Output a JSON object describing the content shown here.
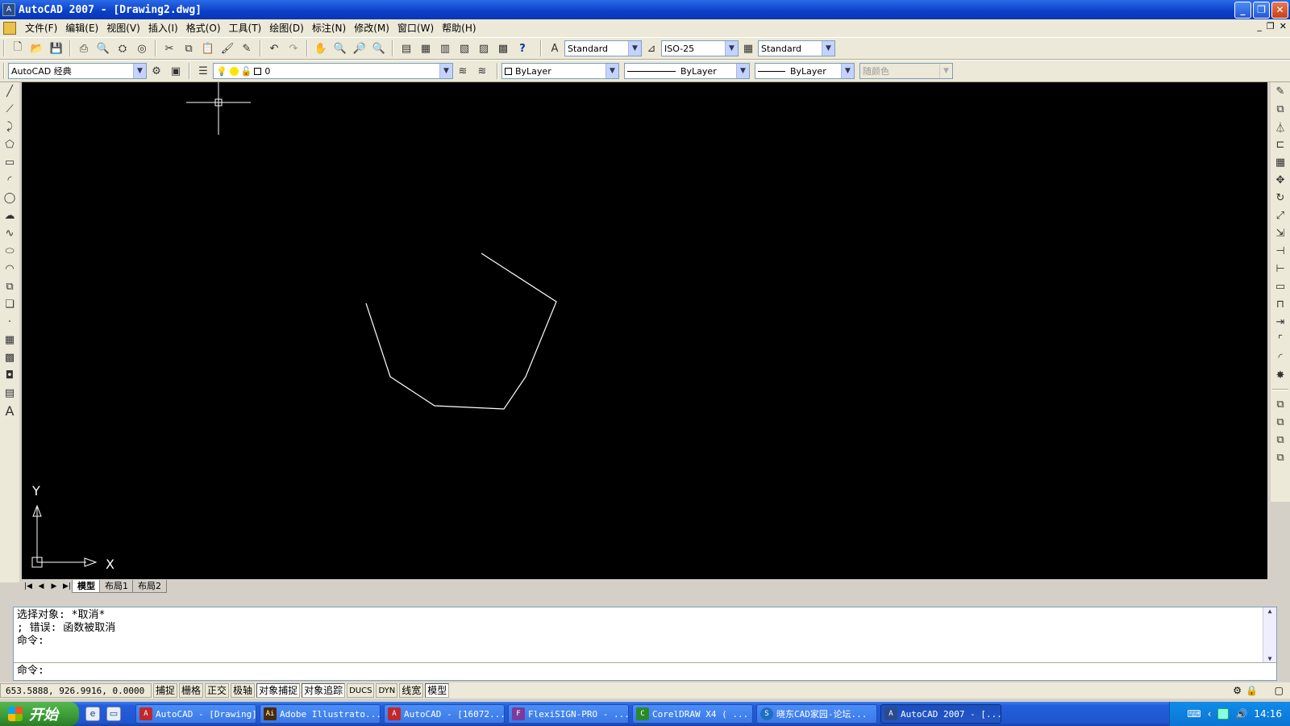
{
  "window": {
    "title": "AutoCAD 2007 - [Drawing2.dwg]"
  },
  "menu": [
    "文件(F)",
    "编辑(E)",
    "视图(V)",
    "插入(I)",
    "格式(O)",
    "工具(T)",
    "绘图(D)",
    "标注(N)",
    "修改(M)",
    "窗口(W)",
    "帮助(H)"
  ],
  "styles_toolbar": {
    "text_style": "Standard",
    "dim_style": "ISO-25",
    "table_style": "Standard"
  },
  "workspace": {
    "value": "AutoCAD 经典"
  },
  "layer": {
    "current": "0"
  },
  "properties_toolbar": {
    "color": "ByLayer",
    "linetype": "ByLayer",
    "lineweight": "ByLayer",
    "plotstyle": "随颜色"
  },
  "canvas": {
    "background": "#000000",
    "entity_color": "#ffffff",
    "ucs_x": "X",
    "ucs_y": "Y"
  },
  "layout_tabs": [
    "模型",
    "布局1",
    "布局2"
  ],
  "command": {
    "history": [
      "选择对象: *取消*",
      "; 错误: 函数被取消",
      "命令:"
    ],
    "prompt": "命令:"
  },
  "status": {
    "coords": "653.5888,  926.9916,  0.0000",
    "buttons": [
      {
        "label": "捕捉",
        "on": false
      },
      {
        "label": "栅格",
        "on": false
      },
      {
        "label": "正交",
        "on": false
      },
      {
        "label": "极轴",
        "on": false
      },
      {
        "label": "对象捕捉",
        "on": true
      },
      {
        "label": "对象追踪",
        "on": true
      },
      {
        "label": "DUCS",
        "on": false
      },
      {
        "label": "DYN",
        "on": false
      },
      {
        "label": "线宽",
        "on": false
      },
      {
        "label": "模型",
        "on": true
      }
    ]
  },
  "taskbar": {
    "start": "开始",
    "tasks": [
      {
        "label": "AutoCAD - [Drawing]",
        "icon_color": "#c0282d",
        "active": false
      },
      {
        "label": "Adobe Illustrato...",
        "icon_color": "#4a2a00",
        "active": false
      },
      {
        "label": "AutoCAD - [16072...",
        "icon_color": "#c0282d",
        "active": false
      },
      {
        "label": "FlexiSIGN-PRO - ...",
        "icon_color": "#7a3b9c",
        "active": false
      },
      {
        "label": "CorelDRAW X4 ( ...",
        "icon_color": "#2a8a2a",
        "active": false
      },
      {
        "label": "晓东CAD家园-论坛...",
        "icon_color": "#1f6fc0",
        "active": false
      },
      {
        "label": "AutoCAD 2007 - [...",
        "icon_color": "#2b4c8a",
        "active": true
      }
    ],
    "clock": "14:16"
  }
}
